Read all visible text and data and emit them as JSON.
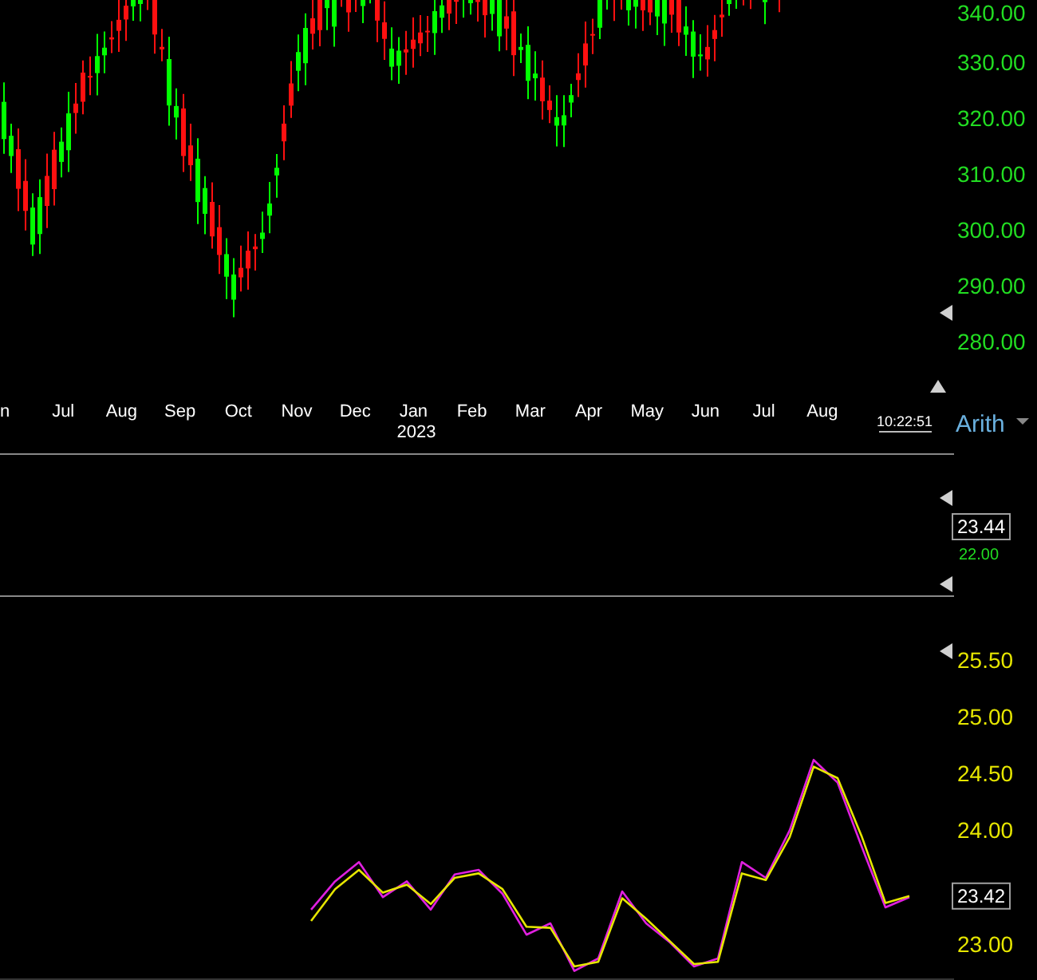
{
  "price_pane": {
    "price_ticks": [
      "340.00",
      "330.00",
      "320.00",
      "310.00",
      "300.00",
      "290.00",
      "280.00"
    ],
    "months": [
      "n",
      "Jul",
      "Aug",
      "Sep",
      "Oct",
      "Nov",
      "Dec",
      "Jan",
      "Feb",
      "Mar",
      "Apr",
      "May",
      "Jun",
      "Jul",
      "Aug"
    ],
    "year_label": "2023",
    "time": "10:22:51",
    "scale": "Arith"
  },
  "middle_pane": {
    "tick": "22.00",
    "value_box": "23.44"
  },
  "lower_pane": {
    "value_box": "23.42",
    "chart_data": {
      "type": "line",
      "ylim": [
        22.68,
        26.07
      ],
      "categories": [
        null,
        null,
        null,
        null,
        null,
        null,
        null,
        null,
        null,
        null,
        null,
        null,
        null,
        null,
        null,
        null,
        null,
        null,
        null,
        null,
        null,
        null,
        null,
        null,
        null,
        null
      ],
      "yticks": [
        {
          "value": 23,
          "label": "23.00"
        },
        {
          "value": 24,
          "label": "24.00"
        },
        {
          "value": 24.5,
          "label": "24.50"
        },
        {
          "value": 25,
          "label": "25.00"
        },
        {
          "value": 25.5,
          "label": "25.50"
        }
      ],
      "series": [
        {
          "color": "#e020e0",
          "values": [
            23.3,
            23.55,
            23.72,
            23.41,
            23.55,
            23.3,
            23.61,
            23.65,
            23.44,
            23.08,
            23.18,
            22.76,
            22.87,
            23.46,
            23.18,
            23.01,
            22.8,
            22.87,
            23.72,
            23.58,
            24.0,
            24.62,
            24.42,
            23.86,
            23.32,
            23.41
          ]
        },
        {
          "color": "#e6e600",
          "values": [
            23.2,
            23.48,
            23.65,
            23.45,
            23.52,
            23.35,
            23.58,
            23.62,
            23.48,
            23.15,
            23.14,
            22.8,
            22.84,
            23.4,
            23.22,
            23.02,
            22.82,
            22.84,
            23.62,
            23.56,
            23.94,
            24.56,
            24.46,
            23.95,
            23.36,
            23.42
          ]
        }
      ]
    }
  }
}
